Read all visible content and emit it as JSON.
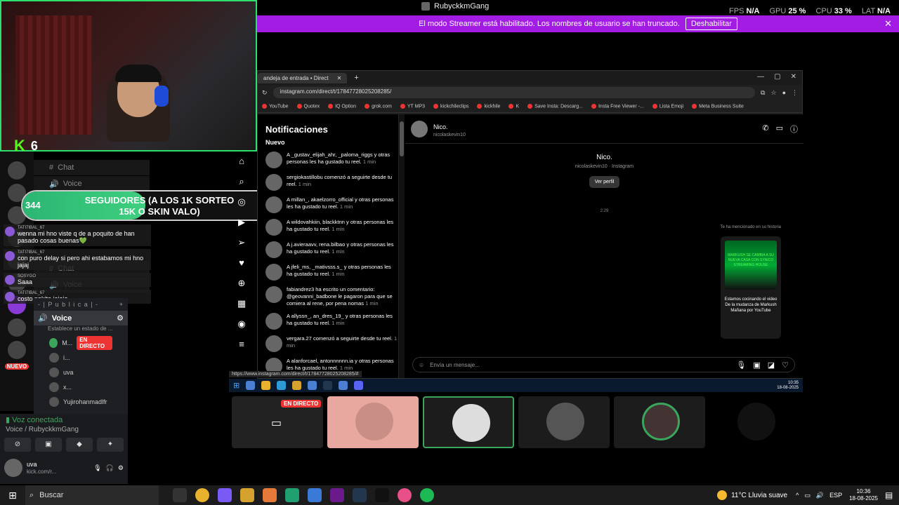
{
  "app": {
    "title": "RubyckkmGang",
    "fps_label": "FPS",
    "fps": "N/A",
    "gpu_label": "GPU",
    "gpu": "25 %",
    "cpu_label": "CPU",
    "cpu": "33 %",
    "lat_label": "LAT",
    "lat": "N/A"
  },
  "streamer_bar": {
    "message": "El modo Streamer está habilitado. Los nombres de usuario se han truncado.",
    "button": "Deshabilitar",
    "close": "✕"
  },
  "webcam": {
    "kick_count": "6",
    "kick_logo": "K"
  },
  "goal": {
    "current": "344",
    "label": "SEGUIDORES (A LOS 1K SORTEO 15K O SKIN VALO)",
    "target": "1000",
    "progress_fraction": 0.344
  },
  "channels": {
    "items": [
      "Chat",
      "Voice",
      "Chat",
      "Voice"
    ]
  },
  "chat_overlay": {
    "messages": [
      {
        "name": "TATI7IBAL_67",
        "text": "wenna mi hno viste q de a poquito de han pasado cosas buenas💚"
      },
      {
        "name": "TATI7IBAL_67",
        "text": "con puro delay si pero ahi estabamos mi hno jajaj"
      },
      {
        "name": "SOSYGO",
        "text": "Saaa"
      },
      {
        "name": "TATI7IBAL_67",
        "text": "costo pokito jajaja"
      }
    ]
  },
  "discord": {
    "category": "- | P u b l i c a | -",
    "voice_channel": "Voice",
    "voice_status": "Establece un estado de ...",
    "users": [
      {
        "name": "M...",
        "live": "EN DIRECTO"
      },
      {
        "name": "i...",
        "live": ""
      },
      {
        "name": "uva",
        "live": ""
      },
      {
        "name": "x...",
        "live": ""
      },
      {
        "name": "Yujirohanmadlfr",
        "live": ""
      }
    ],
    "nuevo": "NUEVO",
    "connected": "Voz conectada",
    "connected_sub": "Voice / RubyckkmGang",
    "user": {
      "name": "uva",
      "status": "kick.com/r..."
    }
  },
  "browser": {
    "tab_title": "andeja de entrada • Direct",
    "tab_close": "✕",
    "new_tab": "+",
    "url": "instagram.com/direct/t/17847728025208285/",
    "bookmarks": [
      "YouTube",
      "Quotex",
      "IQ Option",
      "grok.com",
      "YT MP3",
      "kickchileclips",
      "kickhile",
      "K",
      "Save Insta: Descarg...",
      "Insta Free Viewer -...",
      "Lista Emoji",
      "Meta Business Suite"
    ],
    "status_url": "https://www.instagram.com/direct/t/17847728025208285/#"
  },
  "notifications": {
    "title": "Notificaciones",
    "new_label": "Nuevo",
    "items": [
      {
        "text": "A _gustav_elijah_ahr, _paloma_riggs y otras personas les ha gustado tu reel.",
        "time": "1 min"
      },
      {
        "text": "sergiokastillobu comenzó a seguirte desde tu reel.",
        "time": "1 min"
      },
      {
        "text": "A millan_, akaelzorro_official y otras personas les ha gustado tu reel.",
        "time": "1 min"
      },
      {
        "text": "A wildovahkiin, blackktnn y otras personas les ha gustado tu reel.",
        "time": "1 min"
      },
      {
        "text": "A j.avieraavv, rena.bilbao y otras personas les ha gustado tu reel.",
        "time": "1 min"
      },
      {
        "text": "A jfeli_ms, _mativsss.s_ y otras personas les ha gustado tu reel.",
        "time": "1 min"
      },
      {
        "text": "fabiandrez3 ha escrito un comentario: @geovanni_badbone le pagaron para que se comiera al rene, por pena nomas",
        "time": "1 min"
      },
      {
        "text": "A allyssn_, an_dres_19_ y otras personas les ha gustado tu reel.",
        "time": "1 min"
      },
      {
        "text": "vergara.27 comenzó a seguirte desde tu reel.",
        "time": "1 min"
      },
      {
        "text": "A alanforcael, antonnnnnn.ia y otras personas les ha gustado tu reel.",
        "time": "1 min"
      }
    ]
  },
  "dm": {
    "name": "Nico.",
    "username": "nicolaskevin10",
    "profile_sub": "nicolaskevin10 · Instagram",
    "view_profile": "Ver perfil",
    "timestamp": "2:29",
    "mention_note": "Te ha mencionado en su historia",
    "story_image_text": "MARKUSH SE CAMBIA A SU NUEVA CASA CON SYNICO STREAMING HOUSE",
    "story_text": "Estamos cocinando el video De la mudanza de Markush Mañana por YouTube",
    "composer_placeholder": "Envía un mensaje..."
  },
  "inner_taskbar": {
    "time": "10:35",
    "date": "18-08-2025"
  },
  "tiles": {
    "live_badge": "EN DIRECTO"
  },
  "taskbar": {
    "search": "Buscar",
    "weather": "11°C  Lluvia suave",
    "lang": "ESP",
    "time": "10:36",
    "date": "18-08-2025"
  },
  "colors": {
    "accent": "#a21ce3",
    "kick": "#53fc18",
    "live": "#e33333",
    "voice": "#3ba55c"
  }
}
